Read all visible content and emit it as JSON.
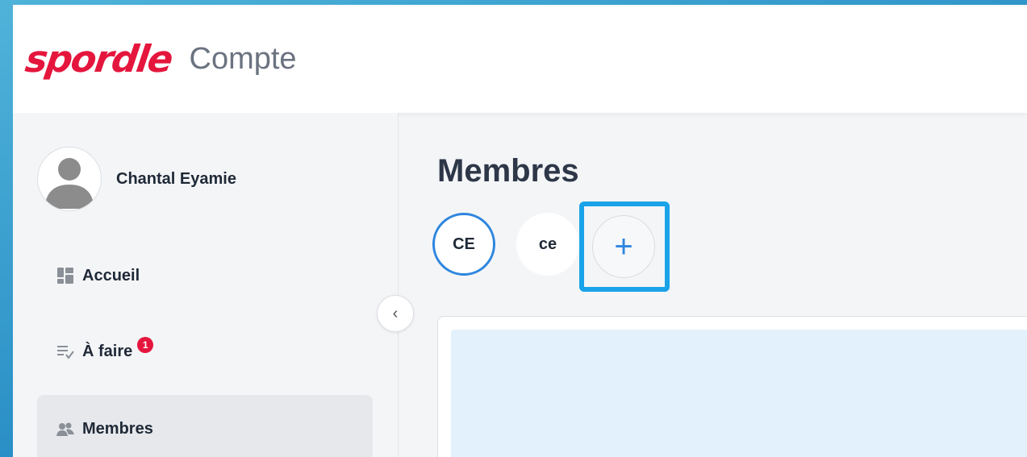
{
  "header": {
    "logo_text": "spordle",
    "app_name": "Compte"
  },
  "user": {
    "name": "Chantal Eyamie",
    "avatar_icon": "user-avatar-icon"
  },
  "sidebar": {
    "items": [
      {
        "label": "Accueil",
        "icon": "dashboard-icon",
        "active": false
      },
      {
        "label": "À faire",
        "icon": "checklist-icon",
        "active": false,
        "badge": "1"
      },
      {
        "label": "Membres",
        "icon": "members-icon",
        "active": true
      }
    ],
    "collapse_icon": "chevron-left-icon",
    "collapse_glyph": "‹"
  },
  "main": {
    "title": "Membres",
    "members": [
      {
        "initials": "CE",
        "selected": true
      },
      {
        "initials": "ce",
        "selected": false
      }
    ],
    "add_member_glyph": "+"
  },
  "colors": {
    "brand": "#e5163d",
    "accent": "#2e86de",
    "highlight": "#1aa3e8",
    "card_inner": "#e3f1fc"
  }
}
